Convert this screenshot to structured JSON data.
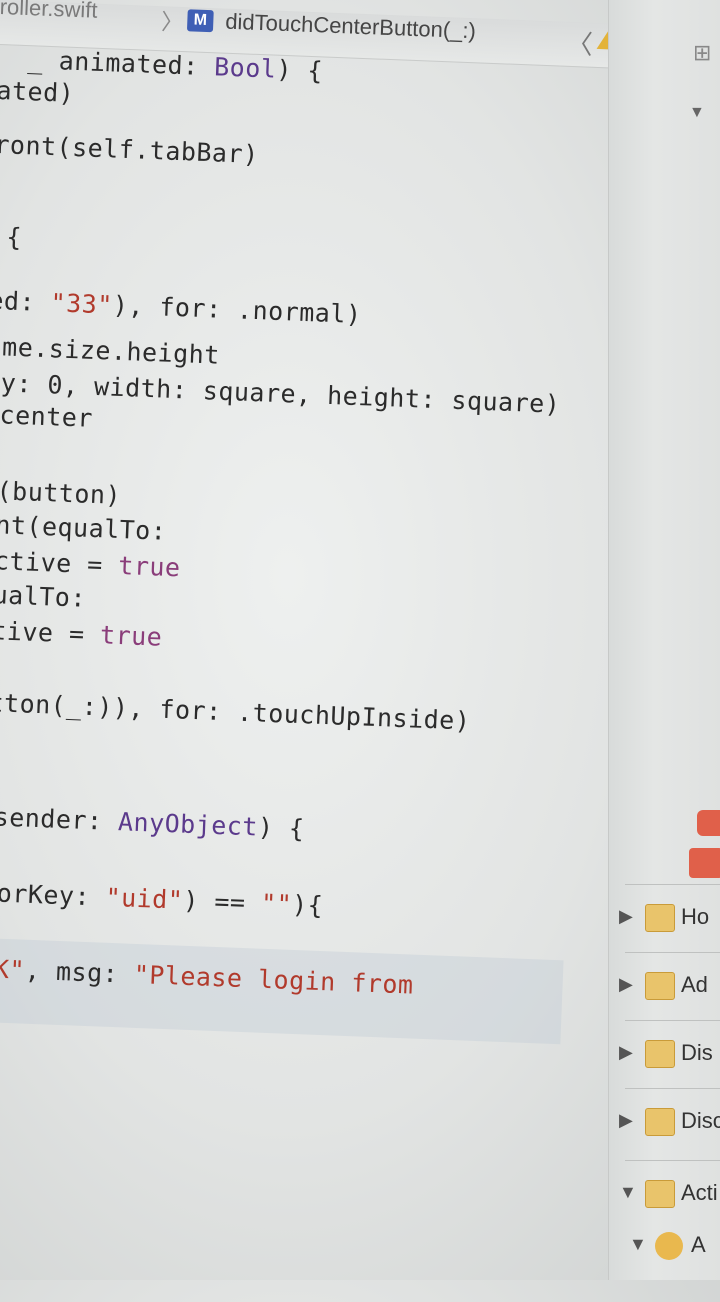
{
  "jump_bar": {
    "file_crumb": "roller.swift",
    "separator": "〉",
    "method_badge": "M",
    "method_name": "didTouchCenterButton(_:)",
    "nav_prev": "〈",
    "nav_next": "〉"
  },
  "code_lines": [
    [
      {
        "t": "_ animated: ",
        "c": "plain"
      },
      {
        "t": "Bool",
        "c": "typ"
      },
      {
        "t": ") {",
        "c": "plain"
      }
    ],
    [
      {
        "t": "ated)",
        "c": "plain"
      }
    ],
    [
      {
        "t": "ront(self.tabBar)",
        "c": "plain"
      }
    ],
    [
      {
        "t": " {",
        "c": "plain"
      }
    ],
    [
      {
        "t": "ed: ",
        "c": "plain"
      },
      {
        "t": "\"33\"",
        "c": "str"
      },
      {
        "t": "), for: .normal)",
        "c": "plain"
      }
    ],
    [
      {
        "t": "ame.size.height",
        "c": "plain"
      }
    ],
    [
      {
        "t": " y: 0, width: square, height: square)",
        "c": "plain"
      }
    ],
    [
      {
        "t": ".center",
        "c": "plain"
      }
    ],
    [
      {
        "t": "t(button)",
        "c": "plain"
      }
    ],
    [
      {
        "t": "int(equalTo:",
        "c": "plain"
      }
    ],
    [
      {
        "t": "Active = ",
        "c": "plain"
      },
      {
        "t": "true",
        "c": "kw"
      }
    ],
    [
      {
        "t": "qualTo:",
        "c": "plain"
      }
    ],
    [
      {
        "t": "ctive = ",
        "c": "plain"
      },
      {
        "t": "true",
        "c": "kw"
      }
    ],
    [
      {
        "t": ":",
        "c": "plain"
      }
    ],
    [
      {
        "t": "utton(_:)), for: .touchUpInside)",
        "c": "plain"
      }
    ],
    [
      {
        "t": "_ sender: ",
        "c": "plain"
      },
      {
        "t": "AnyObject",
        "c": "typ"
      },
      {
        "t": ") {",
        "c": "plain"
      }
    ],
    [
      {
        "t": "(forKey: ",
        "c": "plain"
      },
      {
        "t": "\"uid\"",
        "c": "str"
      },
      {
        "t": ") == ",
        "c": "plain"
      },
      {
        "t": "\"\"",
        "c": "str"
      },
      {
        "t": "){",
        "c": "plain"
      }
    ],
    [
      {
        "t": "TIK\"",
        "c": "str"
      },
      {
        "t": ", msg: ",
        "c": "plain"
      },
      {
        "t": "\"Please login from",
        "c": "str"
      }
    ],
    [
      {
        "t": "\")",
        "c": "str"
      }
    ]
  ],
  "navigator": {
    "items": [
      {
        "label": "Ho"
      },
      {
        "label": "Ad"
      },
      {
        "label": "Dis"
      },
      {
        "label": "Disc"
      },
      {
        "label": "Acti"
      },
      {
        "label": "A"
      }
    ]
  },
  "colors": {
    "keyword": "#8a3d7a",
    "string": "#b13a2c",
    "type": "#5b3a8c",
    "folder": "#e9c46b",
    "method_badge": "#3f5fb5"
  }
}
